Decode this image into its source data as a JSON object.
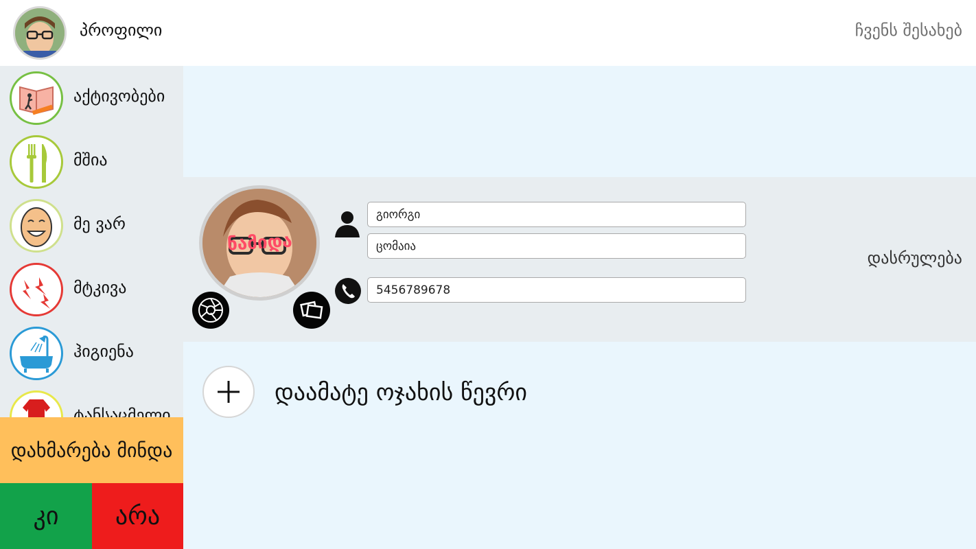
{
  "header": {
    "profile_label": "პროფილი",
    "about_link": "ჩვენს შესახებ"
  },
  "sidebar": {
    "items": [
      {
        "label": "აქტივობები",
        "icon": "activities-book-icon",
        "ring_color": "#77c043"
      },
      {
        "label": "მშია",
        "icon": "fork-knife-icon",
        "ring_color": "#a7c93a"
      },
      {
        "label": "მე ვარ",
        "icon": "smiley-face-icon",
        "ring_color": "#cfe08c"
      },
      {
        "label": "მტკივა",
        "icon": "pain-lightning-icon",
        "ring_color": "#e53935"
      },
      {
        "label": "ჰიგიენა",
        "icon": "bathtub-icon",
        "ring_color": "#2a9ad6"
      },
      {
        "label": "ტანსაცმელი",
        "icon": "clothes-icon",
        "ring_color": "#e8e84a"
      }
    ]
  },
  "help_button": "დახმარება მინდა",
  "yes_button": "კი",
  "no_button": "არა",
  "profile_form": {
    "photo_stamp": "ნამიდა",
    "first_name": "გიორგი",
    "last_name": "ცომაია",
    "phone": "5456789678",
    "done_link": "დასრულება"
  },
  "add_family": {
    "label": "დაამატე ოჯახის წევრი"
  },
  "colors": {
    "help": "#ffbf5b",
    "yes": "#12a24a",
    "no": "#ee1c1c",
    "content_bg": "#eaf6fd",
    "card_bg": "#e8edf0"
  }
}
